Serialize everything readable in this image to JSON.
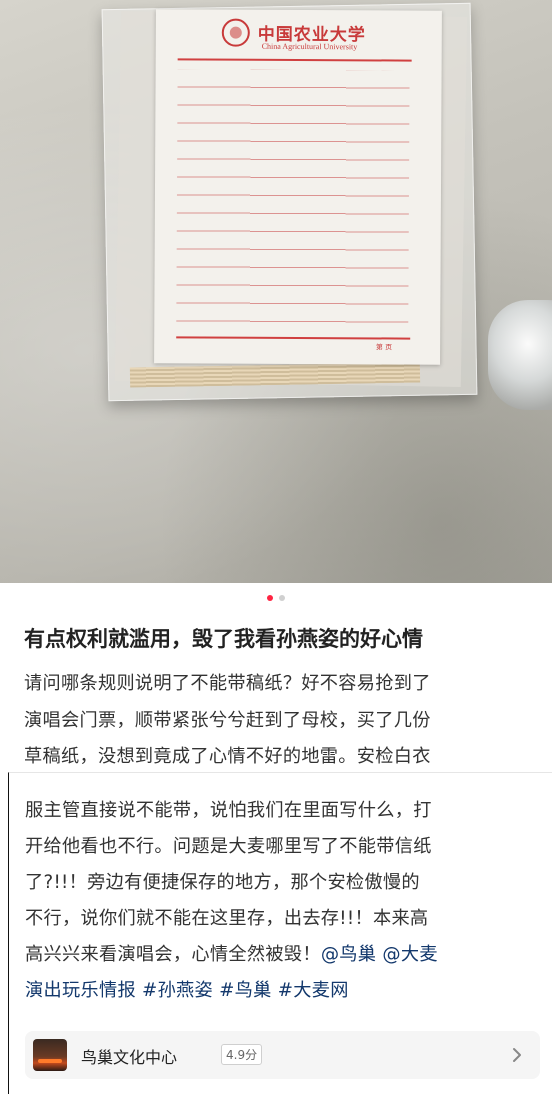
{
  "photo": {
    "university_name_cn": "中国农业大学",
    "university_name_en": "China Agricultural University",
    "page_mark": "第  页"
  },
  "pager": {
    "total": 2,
    "active_index": 0
  },
  "post": {
    "title": "有点权利就滥用，毁了我看孙燕姿的好心情",
    "body_lines_top": [
      "请问哪条规则说明了不能带稿纸？好不容易抢到了",
      "演唱会门票，顺带紧张兮兮赶到了母校，买了几份",
      "草稿纸，没想到竟成了心情不好的地雷。安检白衣"
    ],
    "body_lines_bottom": [
      "服主管直接说不能带，说怕我们在里面写什么，打",
      "开给他看也不行。问题是大麦哪里写了不能带信纸",
      "了?!!！旁边有便捷保存的地方，那个安检傲慢的",
      "不行，说你们就不能在这里存，出去存!!！本来高"
    ],
    "last_line_text": "高兴兴来看演唱会，心情全然被毁！",
    "mentions": [
      "@鸟巢",
      "@大麦"
    ],
    "tag_line_text": "演出玩乐情报",
    "hashtags": [
      "#孙燕姿",
      "#鸟巢",
      "#大麦网"
    ]
  },
  "location_card": {
    "name": "鸟巢文化中心",
    "rating": "4.9分",
    "chevron_icon": "chevron-right-icon"
  },
  "colors": {
    "accent": "#ff2442",
    "link": "#13386c",
    "text": "#333333"
  }
}
